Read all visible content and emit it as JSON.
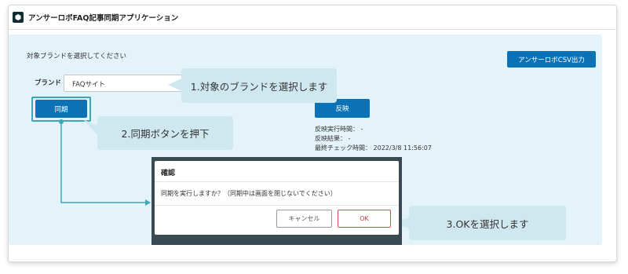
{
  "app": {
    "title": "アンサーロボFAQ記事同期アプリケーション",
    "logo_icon": "app-logo-icon"
  },
  "main": {
    "instruction": "対象ブランドを選択してください",
    "csv_button_label": "アンサーロボCSV出力",
    "brand_label": "ブランド",
    "brand_select_value": "FAQサイト",
    "sync_button_label": "同期",
    "reflect_button_label": "反映",
    "status": {
      "reflect_time": "反映実行時間： -",
      "reflect_result": "反映結果： -",
      "last_check": "最終チェック時間： 2022/3/8 11:56:07"
    }
  },
  "dialog": {
    "title": "確認",
    "message": "同期を実行しますか？（同期中は画面を閉じないでください）",
    "cancel_label": "キャンセル",
    "ok_label": "OK"
  },
  "callouts": {
    "step1": "1.対象のブランドを選択します",
    "step2": "2.同期ボタンを押下",
    "step3": "3.OKを選択します"
  },
  "colors": {
    "primary_button": "#0b72b5",
    "panel_background": "#e4f3fa",
    "callout_background": "#cfe8ef",
    "highlight_stroke": "#3aa8b8",
    "ok_accent": "#d84a4a"
  }
}
